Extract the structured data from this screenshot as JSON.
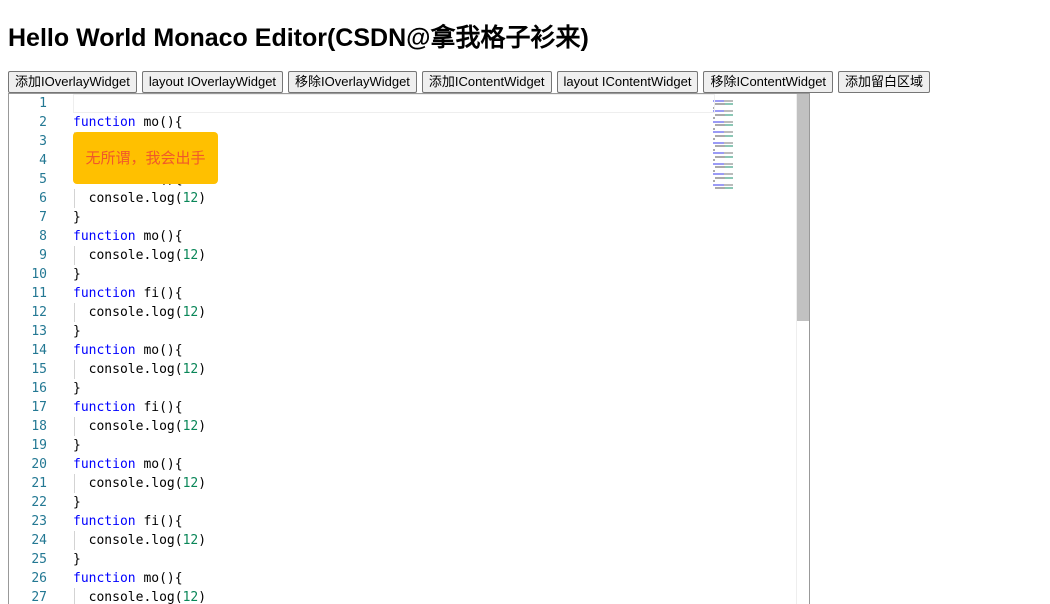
{
  "title": "Hello World Monaco Editor(CSDN@拿我格子衫来)",
  "buttons": [
    "添加IOverlayWidget",
    "layout IOverlayWidget",
    "移除IOverlayWidget",
    "添加IContentWidget",
    "layout IContentWidget",
    "移除IContentWidget",
    "添加留白区域"
  ],
  "editor": {
    "lines": [
      "",
      "function mo(){",
      "  console.log(12)",
      "}",
      "function fi(){",
      "  console.log(12)",
      "}",
      "function mo(){",
      "  console.log(12)",
      "}",
      "function fi(){",
      "  console.log(12)",
      "}",
      "function mo(){",
      "  console.log(12)",
      "}",
      "function fi(){",
      "  console.log(12)",
      "}",
      "function mo(){",
      "  console.log(12)",
      "}",
      "function fi(){",
      "  console.log(12)",
      "}",
      "function mo(){",
      "  console.log(12)"
    ],
    "scroll_position_fraction": 0
  },
  "overlay_widget": {
    "text": "无所谓，我会出手",
    "bg": "#ffc000",
    "color": "#f0582a"
  }
}
